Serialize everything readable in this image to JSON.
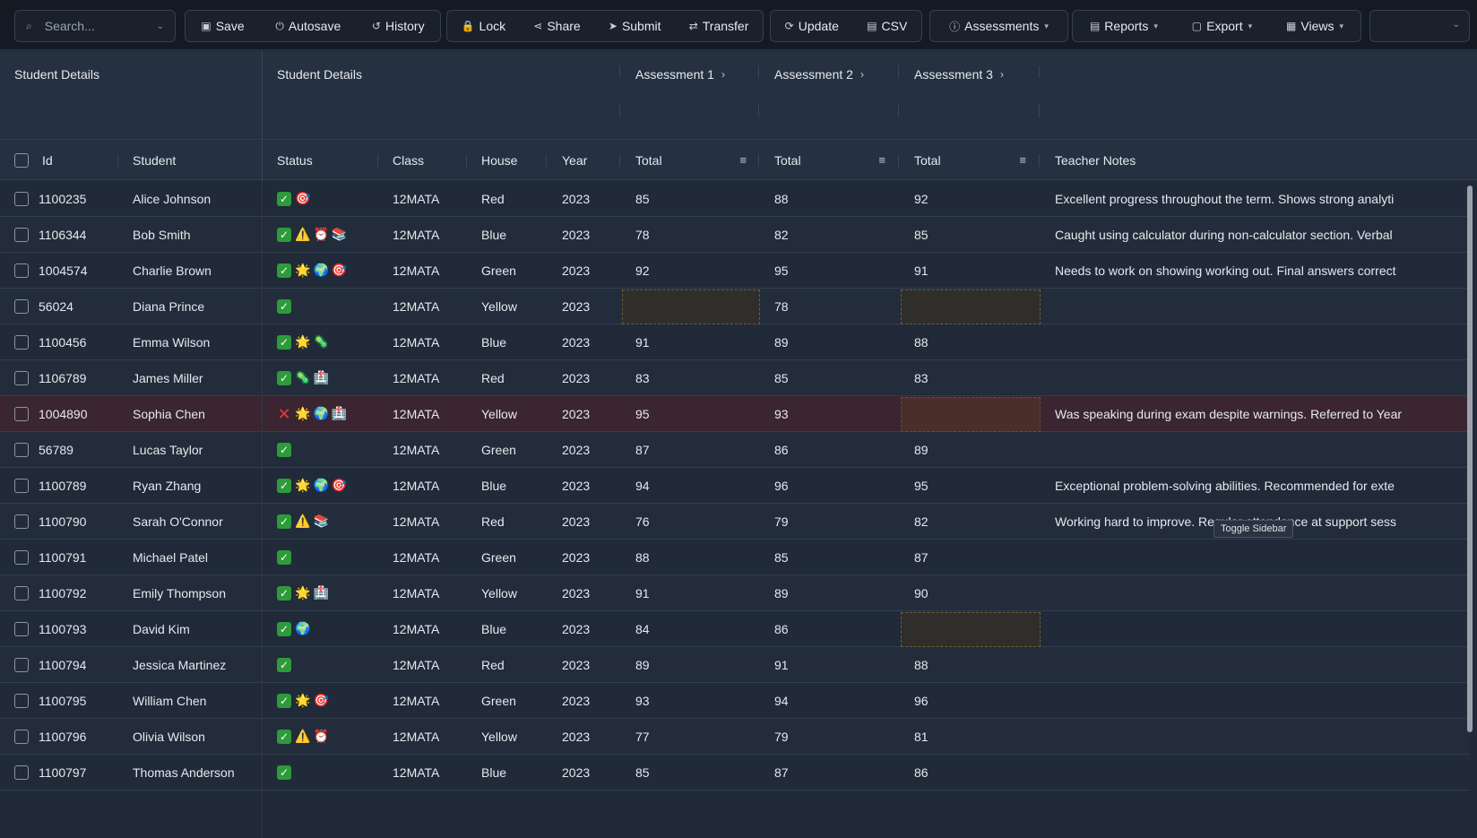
{
  "toolbar": {
    "search_placeholder": "Search...",
    "groups": [
      [
        {
          "label": "Save",
          "icon": "save-icon",
          "glyph": "▣"
        },
        {
          "label": "Autosave",
          "icon": "power-icon",
          "glyph": "⏻"
        },
        {
          "label": "History",
          "icon": "history-icon",
          "glyph": "↺"
        }
      ],
      [
        {
          "label": "Lock",
          "icon": "lock-icon",
          "glyph": "🔒"
        },
        {
          "label": "Share",
          "icon": "share-icon",
          "glyph": "⋖"
        },
        {
          "label": "Submit",
          "icon": "send-icon",
          "glyph": "➤"
        },
        {
          "label": "Transfer",
          "icon": "user-transfer-icon",
          "glyph": "⇄"
        }
      ],
      [
        {
          "label": "Update",
          "icon": "refresh-icon",
          "glyph": "⟳"
        },
        {
          "label": "CSV",
          "icon": "file-icon",
          "glyph": "▤"
        }
      ],
      [
        {
          "label": "Assessments",
          "icon": "info-icon",
          "glyph": "ⓘ",
          "dropdown": true
        }
      ],
      [
        {
          "label": "Reports",
          "icon": "document-icon",
          "glyph": "▤",
          "dropdown": true
        },
        {
          "label": "Export",
          "icon": "file-export-icon",
          "glyph": "▢",
          "dropdown": true
        },
        {
          "label": "Views",
          "icon": "table-icon",
          "glyph": "▦",
          "dropdown": true
        }
      ]
    ]
  },
  "header_groups": [
    "Student Details",
    "Student Details",
    "Assessment 1",
    "Assessment 2",
    "Assessment 3"
  ],
  "columns": [
    "Id",
    "Student",
    "Status",
    "Class",
    "House",
    "Year",
    "Total",
    "Total",
    "Total",
    "Teacher Notes"
  ],
  "tooltip": "Toggle Sidebar",
  "rows": [
    {
      "id": "1100235",
      "student": "Alice Johnson",
      "status": [
        "✅",
        "🎯"
      ],
      "class": "12MATA",
      "house": "Red",
      "year": "2023",
      "a1": "85",
      "a2": "88",
      "a3": "92",
      "notes": "Excellent progress throughout the term. Shows strong analyti"
    },
    {
      "id": "1106344",
      "student": "Bob Smith",
      "status": [
        "✅",
        "⚠️",
        "⏰",
        "📚"
      ],
      "class": "12MATA",
      "house": "Blue",
      "year": "2023",
      "a1": "78",
      "a2": "82",
      "a3": "85",
      "notes": "Caught using calculator during non-calculator section. Verbal"
    },
    {
      "id": "1004574",
      "student": "Charlie Brown",
      "status": [
        "✅",
        "🌟",
        "🌍",
        "🎯"
      ],
      "class": "12MATA",
      "house": "Green",
      "year": "2023",
      "a1": "92",
      "a2": "95",
      "a3": "91",
      "notes": "Needs to work on showing working out. Final answers correct"
    },
    {
      "id": "56024",
      "student": "Diana Prince",
      "status": [
        "✅"
      ],
      "class": "12MATA",
      "house": "Yellow",
      "year": "2023",
      "a1": "",
      "a2": "78",
      "a3": "",
      "notes": ""
    },
    {
      "id": "1100456",
      "student": "Emma Wilson",
      "status": [
        "✅",
        "🌟",
        "🦠"
      ],
      "class": "12MATA",
      "house": "Blue",
      "year": "2023",
      "a1": "91",
      "a2": "89",
      "a3": "88",
      "notes": ""
    },
    {
      "id": "1106789",
      "student": "James Miller",
      "status": [
        "✅",
        "🦠",
        "🏥"
      ],
      "class": "12MATA",
      "house": "Red",
      "year": "2023",
      "a1": "83",
      "a2": "85",
      "a3": "83",
      "notes": ""
    },
    {
      "id": "1004890",
      "student": "Sophia Chen",
      "status": [
        "❌",
        "🌟",
        "🌍",
        "🏥"
      ],
      "class": "12MATA",
      "house": "Yellow",
      "year": "2023",
      "a1": "95",
      "a2": "93",
      "a3": "",
      "notes": "Was speaking during exam despite warnings. Referred to Year"
    },
    {
      "id": "56789",
      "student": "Lucas Taylor",
      "status": [
        "✅"
      ],
      "class": "12MATA",
      "house": "Green",
      "year": "2023",
      "a1": "87",
      "a2": "86",
      "a3": "89",
      "notes": ""
    },
    {
      "id": "1100789",
      "student": "Ryan Zhang",
      "status": [
        "✅",
        "🌟",
        "🌍",
        "🎯"
      ],
      "class": "12MATA",
      "house": "Blue",
      "year": "2023",
      "a1": "94",
      "a2": "96",
      "a3": "95",
      "notes": "Exceptional problem-solving abilities. Recommended for exte"
    },
    {
      "id": "1100790",
      "student": "Sarah O'Connor",
      "status": [
        "✅",
        "⚠️",
        "📚"
      ],
      "class": "12MATA",
      "house": "Red",
      "year": "2023",
      "a1": "76",
      "a2": "79",
      "a3": "82",
      "notes": "Working hard to improve. Regular attendance at support sess"
    },
    {
      "id": "1100791",
      "student": "Michael Patel",
      "status": [
        "✅"
      ],
      "class": "12MATA",
      "house": "Green",
      "year": "2023",
      "a1": "88",
      "a2": "85",
      "a3": "87",
      "notes": ""
    },
    {
      "id": "1100792",
      "student": "Emily Thompson",
      "status": [
        "✅",
        "🌟",
        "🏥"
      ],
      "class": "12MATA",
      "house": "Yellow",
      "year": "2023",
      "a1": "91",
      "a2": "89",
      "a3": "90",
      "notes": ""
    },
    {
      "id": "1100793",
      "student": "David Kim",
      "status": [
        "✅",
        "🌍"
      ],
      "class": "12MATA",
      "house": "Blue",
      "year": "2023",
      "a1": "84",
      "a2": "86",
      "a3": "",
      "notes": ""
    },
    {
      "id": "1100794",
      "student": "Jessica Martinez",
      "status": [
        "✅"
      ],
      "class": "12MATA",
      "house": "Red",
      "year": "2023",
      "a1": "89",
      "a2": "91",
      "a3": "88",
      "notes": ""
    },
    {
      "id": "1100795",
      "student": "William Chen",
      "status": [
        "✅",
        "🌟",
        "🎯"
      ],
      "class": "12MATA",
      "house": "Green",
      "year": "2023",
      "a1": "93",
      "a2": "94",
      "a3": "96",
      "notes": ""
    },
    {
      "id": "1100796",
      "student": "Olivia Wilson",
      "status": [
        "✅",
        "⚠️",
        "⏰"
      ],
      "class": "12MATA",
      "house": "Yellow",
      "year": "2023",
      "a1": "77",
      "a2": "79",
      "a3": "81",
      "notes": ""
    },
    {
      "id": "1100797",
      "student": "Thomas Anderson",
      "status": [
        "✅"
      ],
      "class": "12MATA",
      "house": "Blue",
      "year": "2023",
      "a1": "85",
      "a2": "87",
      "a3": "86",
      "notes": ""
    }
  ]
}
